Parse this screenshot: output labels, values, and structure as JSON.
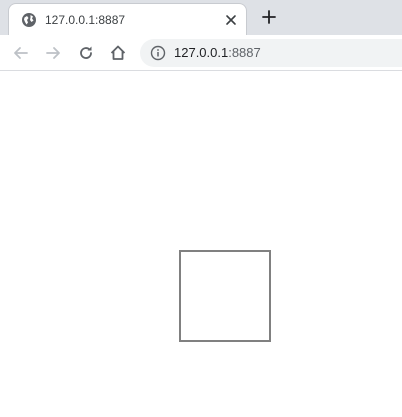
{
  "tab": {
    "title": "127.0.0.1:8887",
    "favicon": "globe-icon",
    "close_icon": "close-icon"
  },
  "new_tab_icon": "plus-icon",
  "toolbar": {
    "back_icon": "arrow-left-icon",
    "forward_icon": "arrow-right-icon",
    "reload_icon": "reload-icon",
    "home_icon": "home-icon",
    "site_info_icon": "info-icon"
  },
  "omnibox": {
    "host": "127.0.0.1",
    "port": ":8887"
  },
  "colors": {
    "tab_strip": "#dee1e6",
    "omnibox_bg": "#f1f3f4",
    "icon_active": "#5f6368",
    "icon_disabled": "#bdc1c6",
    "square_border": "#808080"
  }
}
